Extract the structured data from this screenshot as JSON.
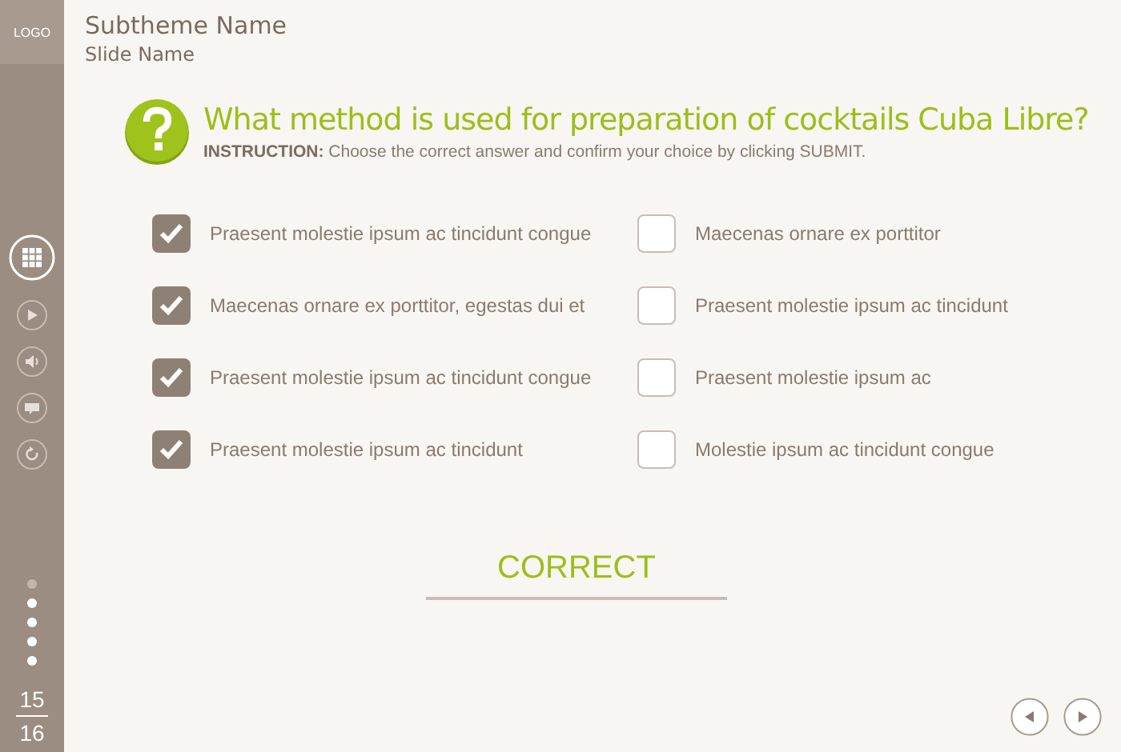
{
  "sidebar": {
    "logo": "LOGO",
    "tools": [
      {
        "kind": "menu"
      },
      {
        "kind": "play"
      },
      {
        "kind": "audio"
      },
      {
        "kind": "comment"
      },
      {
        "kind": "replay"
      }
    ],
    "progress_dots": [
      {
        "selected": true
      },
      {
        "selected": false
      },
      {
        "selected": false
      },
      {
        "selected": false
      },
      {
        "selected": false
      }
    ],
    "current_page": "15",
    "total_pages": "16"
  },
  "header": {
    "subtheme": "Subtheme Name",
    "slide": "Slide Name"
  },
  "question": {
    "text": "What method is used for preparation of cocktails Cuba Libre?",
    "instruction": "**INSTRUCTION:** Choose the correct answer and confirm your choice by clicking SUBMIT."
  },
  "options": [
    {
      "label": "Praesent molestie ipsum ac tincidunt congue",
      "checked": true
    },
    {
      "label": "Maecenas ornare ex porttitor",
      "checked": false
    },
    {
      "label": "Maecenas ornare ex porttitor, egestas dui et",
      "checked": true
    },
    {
      "label": "Praesent molestie ipsum ac tincidunt",
      "checked": false
    },
    {
      "label": "Praesent molestie ipsum ac tincidunt congue",
      "checked": true
    },
    {
      "label": "Praesent molestie ipsum ac",
      "checked": false
    },
    {
      "label": "Praesent molestie ipsum ac tincidunt",
      "checked": true
    },
    {
      "label": "Molestie ipsum ac tincidunt congue",
      "checked": false
    }
  ],
  "feedback": "CORRECT",
  "navigation": [
    {
      "kind": "previous"
    },
    {
      "kind": "next"
    }
  ]
}
